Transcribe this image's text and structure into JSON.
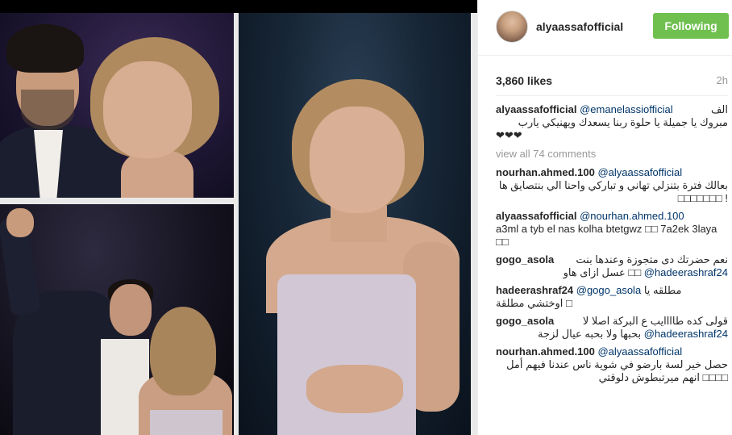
{
  "post": {
    "username": "alyaassafofficial",
    "follow_label": "Following",
    "likes": "3,860 likes",
    "age": "2h",
    "view_all": "view all 74 comments"
  },
  "colors": {
    "follow_green": "#70c050",
    "mention_blue": "#003569",
    "muted_gray": "#999999"
  },
  "caption": {
    "user": "alyaassafofficial",
    "mention": "@emanelassiofficial",
    "text_line1": "الف",
    "text_line2": "مبروك يا جميلة يا حلوة ربنا يسعدك ويهنيكي يارب",
    "hearts": "❤❤❤"
  },
  "comments": [
    {
      "user": "nourhan.ahmed.100",
      "mention": "@alyaassafofficial",
      "text": "بعالك فترة بتنزلي تهاني و تباركي واحنا الي بنتصايق ها ! □□□□□□□"
    },
    {
      "user": "alyaassafofficial",
      "mention": "@nourhan.ahmed.100",
      "text": "a3ml a tyb el nas kolha btetgwz □□ 7a2ek 3laya □□"
    },
    {
      "user": "gogo_asola",
      "mention": "@hadeerashraf24",
      "text_pre": "نعم حضرتك دى متجوزة وعندها بنت",
      "text_post": "عسل ازاى هاو □□"
    },
    {
      "user": "hadeerashraf24",
      "mention": "@gogo_asola",
      "text": "مطلقه يا",
      "text_line2": "□ اوختشي مطلقة"
    },
    {
      "user": "gogo_asola",
      "mention": "@hadeerashraf24",
      "text_pre": "قولى كده طاااايب ع البركة اصلا لا",
      "text_post": "بحبها ولا بحبه عيال لزجة"
    },
    {
      "user": "nourhan.ahmed.100",
      "mention": "@alyaassafofficial",
      "text": "حصل خير لسة بارضو في شوية ناس عندنا فيهم أمل □□□□ انهم ميرتبطوش دلوقتي"
    }
  ]
}
